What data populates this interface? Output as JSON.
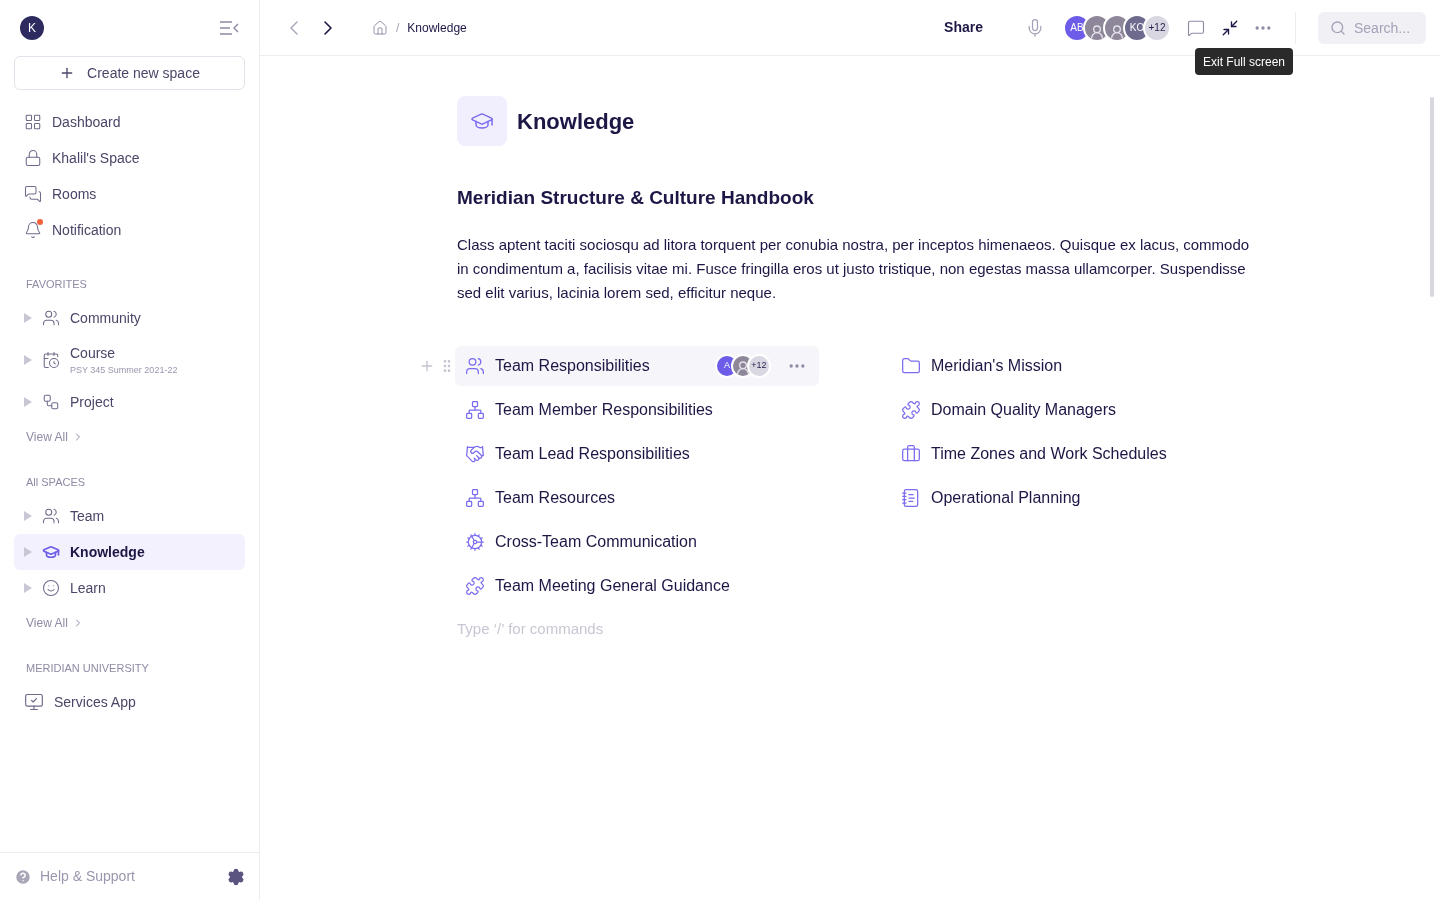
{
  "sidebar": {
    "avatar": "K",
    "create_button": "Create new space",
    "nav": [
      {
        "label": "Dashboard",
        "unread": false
      },
      {
        "label": "Khalil's Space",
        "unread": false
      },
      {
        "label": "Rooms",
        "unread": false
      },
      {
        "label": "Notification",
        "unread": true
      }
    ],
    "sections": [
      {
        "title": "FAVORITES",
        "items": [
          {
            "label": "Community",
            "selected": false
          },
          {
            "label": "Course",
            "subtitle": "PSY 345 Summer 2021-22",
            "selected": false
          },
          {
            "label": "Project",
            "selected": false
          }
        ],
        "view_all": "View All"
      },
      {
        "title": "All SPACES",
        "items": [
          {
            "label": "Team",
            "selected": false
          },
          {
            "label": "Knowledge",
            "selected": true
          },
          {
            "label": "Learn",
            "selected": false
          }
        ],
        "view_all": "View All"
      },
      {
        "title": "MERIDIAN UNIVERSITY",
        "apps": [
          {
            "label": "Services App"
          }
        ]
      }
    ],
    "footer": {
      "help": "Help & Support"
    }
  },
  "header": {
    "breadcrumb_separator": "/",
    "breadcrumb": [
      "Knowledge"
    ],
    "share": "Share",
    "avatars": [
      {
        "kind": "initials",
        "label": "AB",
        "color": "#6c5ce7"
      },
      {
        "kind": "photo"
      },
      {
        "kind": "photo"
      },
      {
        "kind": "initials",
        "label": "KO",
        "color": "#6e6a8e"
      },
      {
        "kind": "count",
        "label": "+12"
      }
    ],
    "tooltip": "Exit Full screen",
    "search": {
      "placeholder": "Search..."
    }
  },
  "page": {
    "title": "Knowledge",
    "heading": "Meridian Structure & Culture Handbook",
    "body": "Class aptent taciti sociosqu ad litora torquent per conubia nostra, per inceptos himenaeos. Quisque ex lacus, commodo in condimentum a, facilisis vitae mi. Fusce fringilla eros ut justo tristique, non egestas massa ullamcorper. Suspendisse sed elit varius, lacinia lorem sed, efficitur neque.",
    "links_left": [
      {
        "label": "Team Responsibilities",
        "selected": true,
        "avatars": [
          {
            "kind": "initials",
            "label": "A",
            "color": "#6c5ce7"
          },
          {
            "kind": "photo"
          },
          {
            "kind": "count",
            "label": "+12"
          }
        ]
      },
      {
        "label": "Team Member Responsibilities",
        "selected": false
      },
      {
        "label": "Team Lead Responsibilities",
        "selected": false
      },
      {
        "label": "Team Resources",
        "selected": false
      },
      {
        "label": "Cross-Team Communication",
        "selected": false
      },
      {
        "label": "Team Meeting General Guidance",
        "selected": false
      }
    ],
    "links_right": [
      {
        "label": "Meridian's Mission",
        "selected": false
      },
      {
        "label": "Domain Quality Managers",
        "selected": false
      },
      {
        "label": "Time Zones and Work Schedules",
        "selected": false
      },
      {
        "label": "Operational Planning",
        "selected": false
      }
    ],
    "command_placeholder": "Type ‘/’ for commands"
  }
}
